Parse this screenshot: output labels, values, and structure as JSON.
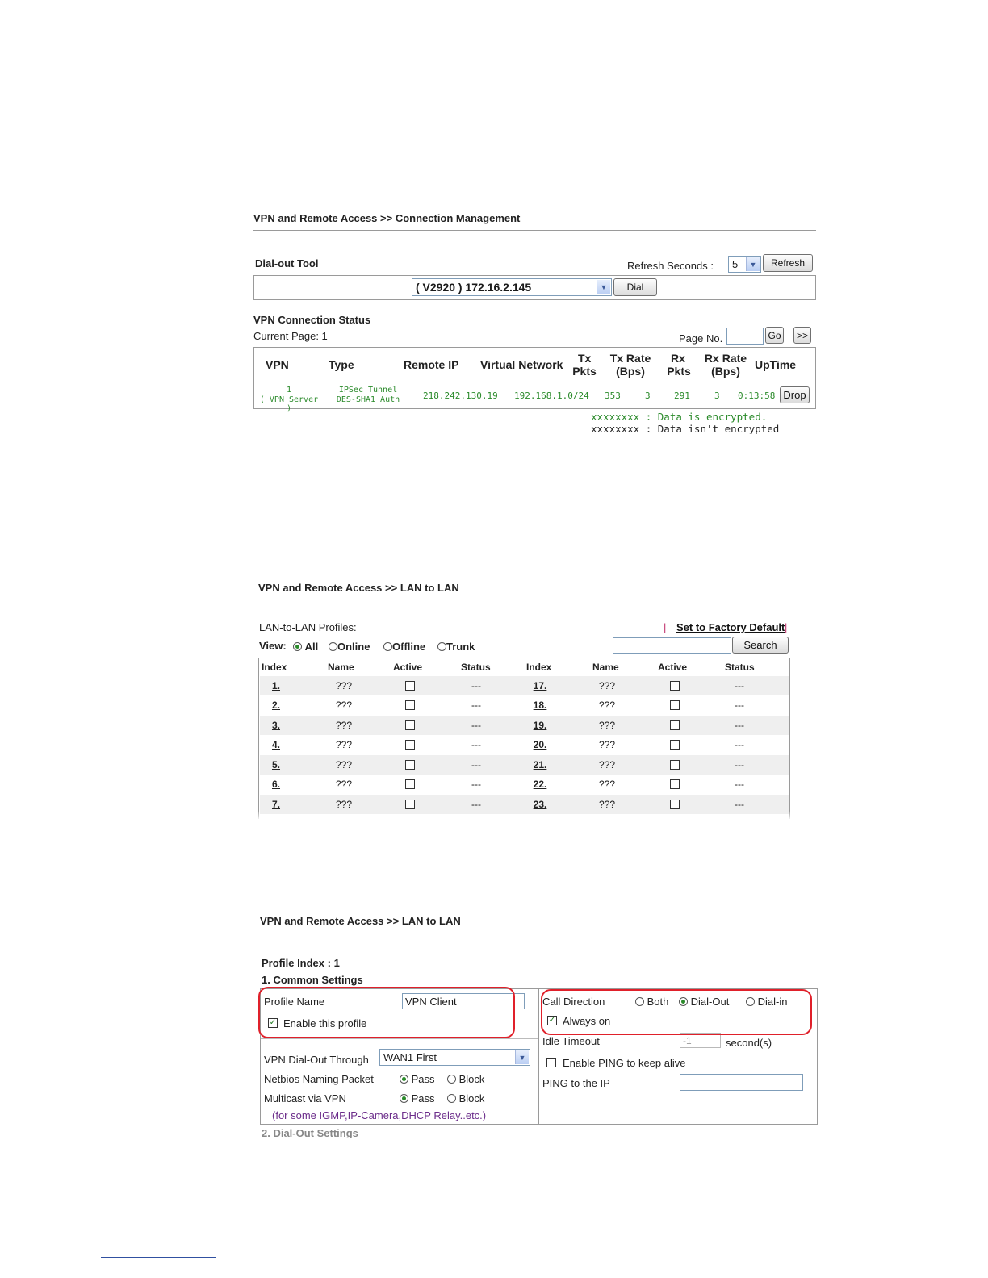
{
  "section1": {
    "breadcrumb": "VPN and Remote Access >> Connection Management",
    "dialout_tool_label": "Dial-out Tool",
    "refresh_seconds_label": "Refresh Seconds :",
    "refresh_seconds_value": "5",
    "refresh_button": "Refresh",
    "dial_target_value": "( V2920 ) 172.16.2.145",
    "dial_button": "Dial",
    "status_title": "VPN Connection Status",
    "current_page_label": "Current Page: 1",
    "page_no_label": "Page No.",
    "go_button": "Go",
    "next_button": ">>",
    "columns": {
      "vpn": "VPN",
      "type": "Type",
      "remote_ip": "Remote IP",
      "virtual_network": "Virtual Network",
      "tx_pkts_1": "Tx",
      "tx_pkts_2": "Pkts",
      "tx_rate_1": "Tx Rate",
      "tx_rate_2": "(Bps)",
      "rx_pkts_1": "Rx",
      "rx_pkts_2": "Pkts",
      "rx_rate_1": "Rx Rate",
      "rx_rate_2": "(Bps)",
      "uptime": "UpTime"
    },
    "row": {
      "vpn_1": "1",
      "vpn_2": "( VPN Server )",
      "type_1": "IPSec Tunnel",
      "type_2": "DES-SHA1 Auth",
      "remote_ip": "218.242.130.19",
      "virtual_network": "192.168.1.0/24",
      "tx_pkts": "353",
      "tx_rate": "3",
      "rx_pkts": "291",
      "rx_rate": "3",
      "uptime": "0:13:58",
      "drop_button": "Drop"
    },
    "legend_encrypted": "xxxxxxxx : Data is encrypted.",
    "legend_not_encrypted": "xxxxxxxx : Data isn't encrypted.",
    "colors": {
      "encrypted": "#2a8a2a"
    }
  },
  "section2": {
    "breadcrumb": "VPN and Remote Access >> LAN to LAN",
    "profiles_label": "LAN-to-LAN Profiles:",
    "factory_default_link": "Set to Factory Default",
    "separator": "|",
    "view_label": "View:",
    "view_options": [
      "All",
      "Online",
      "Offline",
      "Trunk"
    ],
    "view_selected": "All",
    "search_button": "Search",
    "columns": [
      "Index",
      "Name",
      "Active",
      "Status",
      "Index",
      "Name",
      "Active",
      "Status"
    ],
    "rows": [
      {
        "li": "1.",
        "ln": "???",
        "ls": "---",
        "ri": "17.",
        "rn": "???",
        "rs": "---"
      },
      {
        "li": "2.",
        "ln": "???",
        "ls": "---",
        "ri": "18.",
        "rn": "???",
        "rs": "---"
      },
      {
        "li": "3.",
        "ln": "???",
        "ls": "---",
        "ri": "19.",
        "rn": "???",
        "rs": "---"
      },
      {
        "li": "4.",
        "ln": "???",
        "ls": "---",
        "ri": "20.",
        "rn": "???",
        "rs": "---"
      },
      {
        "li": "5.",
        "ln": "???",
        "ls": "---",
        "ri": "21.",
        "rn": "???",
        "rs": "---"
      },
      {
        "li": "6.",
        "ln": "???",
        "ls": "---",
        "ri": "22.",
        "rn": "???",
        "rs": "---"
      },
      {
        "li": "7.",
        "ln": "???",
        "ls": "---",
        "ri": "23.",
        "rn": "???",
        "rs": "---"
      }
    ]
  },
  "section3": {
    "breadcrumb": "VPN and Remote Access >> LAN to LAN",
    "profile_index": "Profile Index : 1",
    "common_settings": "1. Common Settings",
    "profile_name_label": "Profile Name",
    "profile_name_value": "VPN Client",
    "enable_profile_label": "Enable this profile",
    "dialout_through_label": "VPN Dial-Out Through",
    "dialout_through_value": "WAN1 First",
    "netbios_label": "Netbios Naming Packet",
    "multicast_label": "Multicast via VPN",
    "pass_label": "Pass",
    "block_label": "Block",
    "multicast_note": "(for some IGMP,IP-Camera,DHCP Relay..etc.)",
    "call_direction_label": "Call Direction",
    "call_options": [
      "Both",
      "Dial-Out",
      "Dial-in"
    ],
    "call_selected": "Dial-Out",
    "always_on_label": "Always on",
    "idle_timeout_label": "Idle Timeout",
    "idle_timeout_value": "-1",
    "idle_timeout_unit": "second(s)",
    "enable_ping_label": "Enable PING to keep alive",
    "ping_ip_label": "PING to the IP",
    "dialout_settings": "2. Dial-Out Settings",
    "colors": {
      "highlight": "#e0202a"
    }
  }
}
